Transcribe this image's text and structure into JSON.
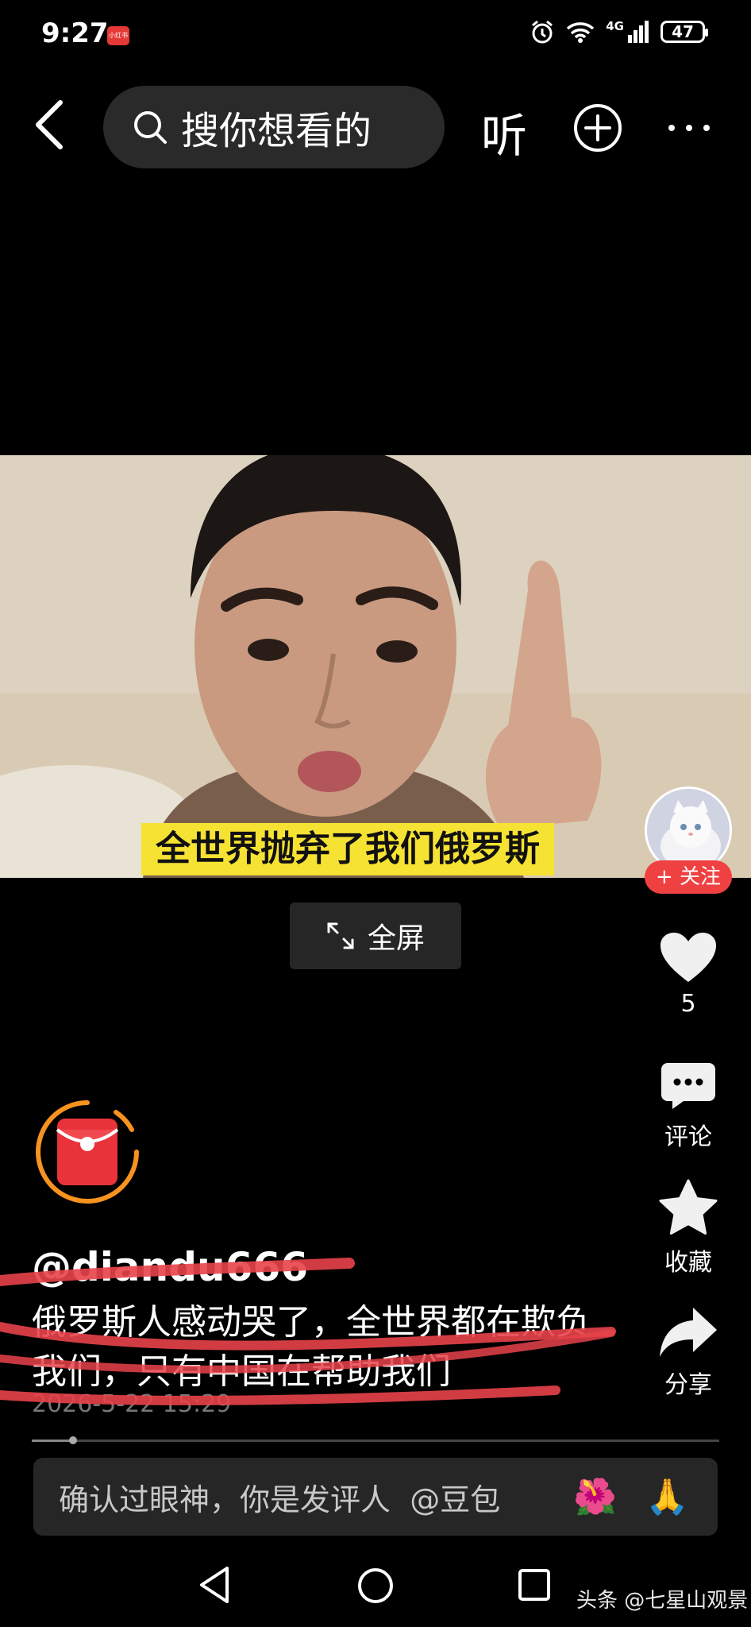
{
  "status": {
    "time": "9:27",
    "badge": "小红书",
    "network": "4G",
    "battery": "47"
  },
  "topbar": {
    "search_placeholder": "搜你想看的",
    "listen_label": "听"
  },
  "video": {
    "subtitle": "全世界抛弃了我们俄罗斯",
    "fullscreen_label": "全屏"
  },
  "rail": {
    "follow_label": "+ 关注",
    "like_count": "5",
    "comment_label": "评论",
    "favorite_label": "收藏",
    "share_label": "分享"
  },
  "post": {
    "username": "@diandu666",
    "description": "俄罗斯人感动哭了，全世界都在欺负我们，只有中国在帮助我们",
    "date": "2026-5-22 15:29",
    "progress": 0.06
  },
  "comment_bar": {
    "placeholder": "确认过眼神，你是发评人",
    "mention": "@豆包",
    "emoji_1": "🌺",
    "emoji_2": "🙏"
  },
  "watermark": "头条 @七星山观景",
  "colors": {
    "accent_red": "#f04142",
    "subtitle_bg": "#f6e232",
    "ring_orange": "#f7931e",
    "scribble_red": "#e8424a"
  },
  "icons": [
    "search-icon",
    "back-icon",
    "plus-circle-icon",
    "more-icon",
    "expand-icon",
    "heart-icon",
    "comment-icon",
    "star-icon",
    "share-icon",
    "red-envelope-icon"
  ]
}
